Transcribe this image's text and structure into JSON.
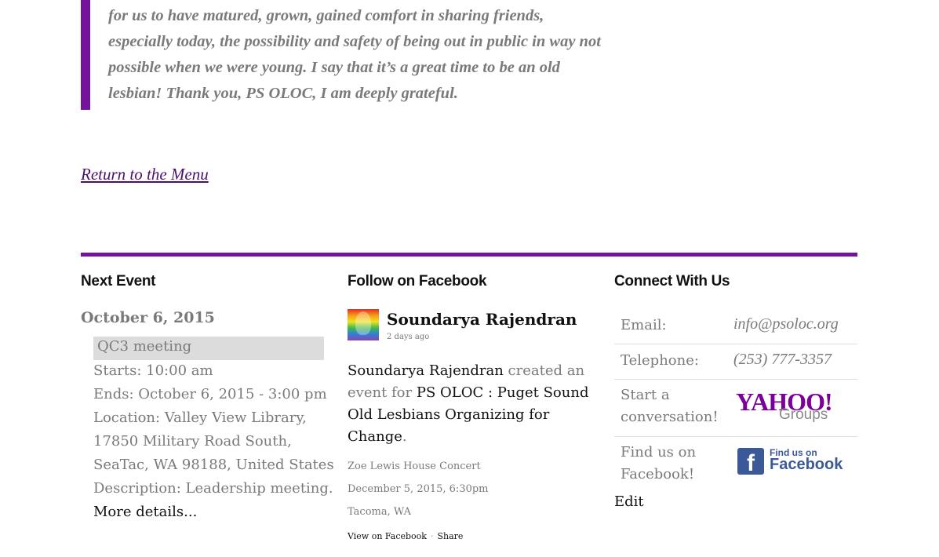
{
  "quote": {
    "lines": [
      "for us to have matured, grown, gained comfort in sharing friends,",
      "especially today, the possibility and safety of being out in public in way not",
      "possible when we were young. I say that it’s a great time to be an old",
      "lesbian! Thank you, PS OLOC, I am deeply grateful."
    ]
  },
  "return_link": "Return to the Menu",
  "next_event": {
    "title": "Next Event",
    "date": "October 6, 2015",
    "name": "QC3 meeting",
    "starts": "Starts: 10:00 am",
    "ends": "Ends: October 6, 2015 - 3:00 pm",
    "location_1": "Location: Valley View Library,",
    "location_2": "17850 Military Road South,",
    "location_3": "SeaTac, WA 98188, United States",
    "description": "Description: Leadership meeting.",
    "more": "More details..."
  },
  "facebook": {
    "title": "Follow on Facebook",
    "author": "Soundarya Rajendran",
    "time": "2 days ago",
    "post_author": "Soundarya Rajendran",
    "post_text_1": " created an",
    "post_text_2": "event for ",
    "post_page_1": "PS OLOC : Puget Sound",
    "post_page_2": "Old Lesbians Organizing for",
    "post_page_3": "Change",
    "post_end": ".",
    "event_title": "Zoe Lewis House Concert",
    "event_date": "December 5, 2015, 6:30pm",
    "event_place": "Tacoma, WA",
    "view_on": "View on Facebook",
    "separator": "·",
    "share": "Share"
  },
  "connect": {
    "title": "Connect With Us",
    "email_label": "Email:",
    "email_value": "info@psoloc.org",
    "phone_label": "Telephone:",
    "phone_value": "(253) 777-3357",
    "conv_label_1": "Start a",
    "conv_label_2": "conversation!",
    "yahoo_logo_text": "YAHOO!",
    "yahoo_groups_text": "Groups",
    "fb_label_1": "Find us on",
    "fb_label_2": "Facebook!",
    "fb_badge_small": "Find us on",
    "fb_badge_big": "Facebook",
    "fb_badge_letter": "f",
    "edit": "Edit"
  },
  "colors": {
    "accent": "#76139d",
    "link": "#4b0f6e",
    "facebook_blue": "#3b5998",
    "yahoo_purple": "#7b0099"
  }
}
